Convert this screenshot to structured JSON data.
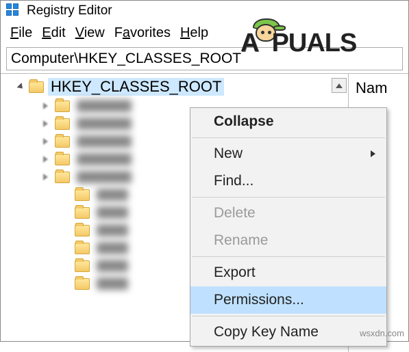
{
  "titlebar": {
    "title": "Registry Editor"
  },
  "menu": {
    "file": "File",
    "edit": "Edit",
    "view": "View",
    "favorites": "Favorites",
    "help": "Help"
  },
  "addressbar": {
    "path": "Computer\\HKEY_CLASSES_ROOT"
  },
  "tree": {
    "selected_node": "HKEY_CLASSES_ROOT"
  },
  "columns": {
    "name": "Nam"
  },
  "context_menu": {
    "collapse": "Collapse",
    "new": "New",
    "find": "Find...",
    "delete": "Delete",
    "rename": "Rename",
    "export": "Export",
    "permissions": "Permissions...",
    "copy_key_name": "Copy Key Name"
  },
  "watermark": {
    "brand": "A  PUALS",
    "source": "wsxdn.com"
  }
}
